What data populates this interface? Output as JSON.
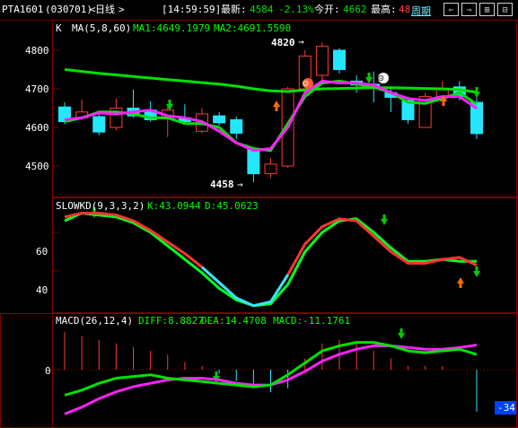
{
  "header": {
    "symbol": "PTA1601",
    "code": "(030701)",
    "period_prefix": "<",
    "period": "日线",
    "period_suffix": ">",
    "time": "[14:59:59]",
    "latest_label": "最新:",
    "latest_value": "4584",
    "change_pct": "-2.13%",
    "open_label": "今开:",
    "open_value": "4662",
    "high_label": "最高:",
    "high_value": "48",
    "period_link": "周期",
    "colors": {
      "up": "#ff3a3a",
      "down": "#23e6ff",
      "ma1": "#00ff00",
      "label": "#ffffff"
    }
  },
  "nav_buttons": [
    {
      "name": "prev-period-button",
      "icon": "arrow-left-icon",
      "glyph": "⇐"
    },
    {
      "name": "next-period-button",
      "icon": "arrow-right-icon",
      "glyph": "⇒"
    },
    {
      "name": "zoom-in-button",
      "icon": "zoom-in-icon",
      "glyph": "⊞"
    },
    {
      "name": "zoom-out-button",
      "icon": "zoom-out-icon",
      "glyph": "⊟"
    }
  ],
  "kline_panel": {
    "label": "K",
    "ma_label": "MA(5,8,60)",
    "ma1_text": "MA1:4649.1979",
    "ma2_text": "MA2:4691.5590",
    "y_ticks": [
      "4800",
      "4700",
      "4600",
      "4500"
    ],
    "high_marker": "4820",
    "low_marker": "4458",
    "happy_face": "☺",
    "sad_face": "☹"
  },
  "kd_panel": {
    "label": "SLOWKD(9,3,3,2)",
    "k_text": "K:43.0944",
    "d_text": "D:45.0623",
    "y_ticks": [
      "60",
      "40"
    ]
  },
  "macd_panel": {
    "label": "MACD(26,12,4)",
    "diff_text": "DIFF:8.8827",
    "dea_text": "DEA:14.4708",
    "macd_text": "MACD:-11.1761",
    "y_ticks": [
      "0"
    ],
    "value_badge": "-34"
  },
  "chart_data": {
    "type": "candlestick",
    "candles": [
      {
        "o": 4653,
        "c": 4615,
        "h": 4665,
        "l": 4608
      },
      {
        "o": 4625,
        "c": 4640,
        "h": 4672,
        "l": 4620
      },
      {
        "o": 4628,
        "c": 4588,
        "h": 4640,
        "l": 4580
      },
      {
        "o": 4600,
        "c": 4650,
        "h": 4675,
        "l": 4592
      },
      {
        "o": 4650,
        "c": 4630,
        "h": 4698,
        "l": 4625
      },
      {
        "o": 4645,
        "c": 4620,
        "h": 4668,
        "l": 4615
      },
      {
        "o": 4622,
        "c": 4645,
        "h": 4655,
        "l": 4575
      },
      {
        "o": 4625,
        "c": 4615,
        "h": 4660,
        "l": 4610
      },
      {
        "o": 4590,
        "c": 4635,
        "h": 4650,
        "l": 4585
      },
      {
        "o": 4630,
        "c": 4612,
        "h": 4640,
        "l": 4605
      },
      {
        "o": 4620,
        "c": 4585,
        "h": 4628,
        "l": 4570
      },
      {
        "o": 4545,
        "c": 4480,
        "h": 4550,
        "l": 4458
      },
      {
        "o": 4480,
        "c": 4505,
        "h": 4520,
        "l": 4470
      },
      {
        "o": 4500,
        "c": 4700,
        "h": 4705,
        "l": 4495
      },
      {
        "o": 4700,
        "c": 4785,
        "h": 4800,
        "l": 4690
      },
      {
        "o": 4735,
        "c": 4810,
        "h": 4820,
        "l": 4710
      },
      {
        "o": 4800,
        "c": 4750,
        "h": 4805,
        "l": 4740
      },
      {
        "o": 4720,
        "c": 4710,
        "h": 4735,
        "l": 4690
      },
      {
        "o": 4712,
        "c": 4706,
        "h": 4745,
        "l": 4665
      },
      {
        "o": 4690,
        "c": 4678,
        "h": 4700,
        "l": 4640
      },
      {
        "o": 4670,
        "c": 4620,
        "h": 4680,
        "l": 4610
      },
      {
        "o": 4600,
        "c": 4680,
        "h": 4690,
        "l": 4600
      },
      {
        "o": 4680,
        "c": 4700,
        "h": 4720,
        "l": 4670
      },
      {
        "o": 4705,
        "c": 4680,
        "h": 4720,
        "l": 4670
      },
      {
        "o": 4665,
        "c": 4584,
        "h": 4680,
        "l": 4570
      }
    ],
    "ma1": [
      4620,
      4625,
      4638,
      4635,
      4640,
      4645,
      4630,
      4625,
      4615,
      4590,
      4560,
      4540,
      4545,
      4600,
      4690,
      4720,
      4715,
      4715,
      4710,
      4690,
      4675,
      4670,
      4680,
      4680,
      4649
    ],
    "ma2": [
      4615,
      4625,
      4640,
      4640,
      4635,
      4625,
      4625,
      4610,
      4610,
      4600,
      4560,
      4545,
      4540,
      4610,
      4680,
      4715,
      4720,
      4712,
      4705,
      4690,
      4665,
      4662,
      4675,
      4690,
      4660
    ],
    "ma3": [
      4750,
      4745,
      4740,
      4736,
      4732,
      4728,
      4724,
      4720,
      4716,
      4712,
      4707,
      4700,
      4695,
      4693,
      4697,
      4700,
      4701,
      4702,
      4703,
      4703,
      4702,
      4701,
      4700,
      4698,
      4691
    ],
    "kd_k": [
      68,
      70,
      70,
      69,
      66,
      61,
      55,
      49,
      42,
      34,
      26,
      22,
      24,
      38,
      54,
      63,
      67,
      66,
      58,
      50,
      44,
      44,
      46,
      47,
      43
    ],
    "kd_d": [
      66,
      70,
      69,
      68,
      65,
      60,
      53,
      46,
      39,
      31,
      25,
      22,
      23,
      33,
      50,
      60,
      66,
      67,
      60,
      52,
      45,
      45,
      46,
      45,
      45
    ],
    "diff": [
      -15,
      -12,
      -8,
      -5,
      -4,
      -3,
      -5,
      -6,
      -7,
      -8,
      -9,
      -10,
      -9,
      -3,
      4,
      11,
      14,
      16,
      16,
      14,
      11,
      10,
      11,
      12,
      8.8827
    ],
    "dea": [
      -26,
      -22,
      -17,
      -13,
      -10,
      -8,
      -6,
      -5,
      -5,
      -6,
      -8,
      -9,
      -9,
      -6,
      -1,
      5,
      9,
      12,
      14,
      14,
      13,
      12,
      12,
      13,
      14.4708
    ],
    "macd": [
      10,
      9,
      8,
      7,
      6,
      5,
      4,
      2,
      1,
      -1,
      -3,
      -5,
      -6,
      -5,
      3,
      7,
      8,
      7,
      5,
      3,
      1,
      1,
      1,
      0,
      -11.1761
    ]
  }
}
